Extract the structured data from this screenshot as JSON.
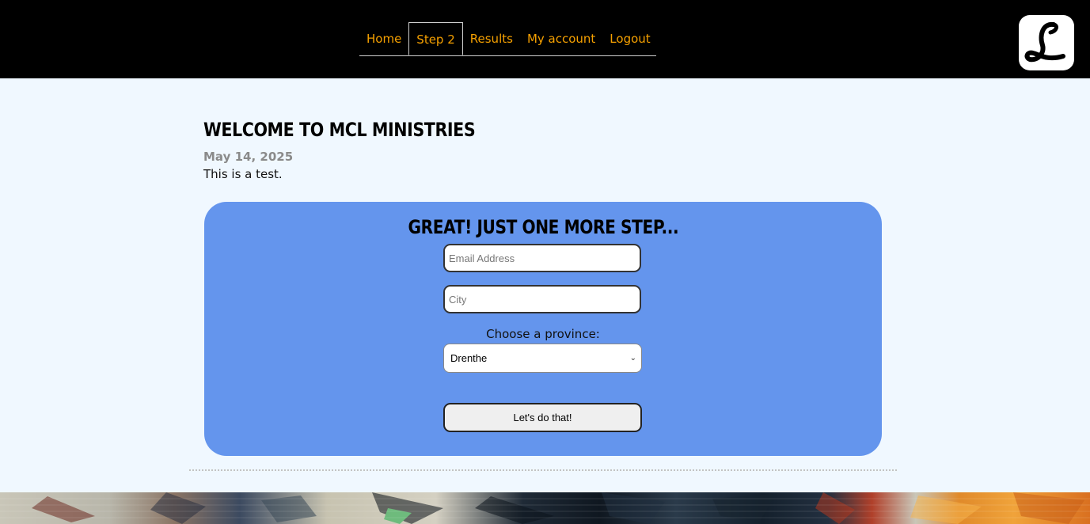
{
  "nav": {
    "items": [
      {
        "label": "Home"
      },
      {
        "label": "Step 2",
        "active": true
      },
      {
        "label": "Results"
      },
      {
        "label": "My account"
      },
      {
        "label": "Logout"
      }
    ]
  },
  "logo": {
    "letter": "L",
    "icon": "script-l-logo"
  },
  "post": {
    "title": "Welcome to MCL Ministries",
    "date": "May 14, 2025",
    "body": "This is a test."
  },
  "form": {
    "title": "Great! Just one more step...",
    "email_placeholder": "Email Address",
    "city_placeholder": "City",
    "province_label": "Choose a province:",
    "province_selected": "Drenthe",
    "submit_label": "Let's do that!"
  },
  "colors": {
    "header_bg": "#000000",
    "nav_text": "#f5a000",
    "page_bg": "#f0f8ff",
    "card_bg": "#6495ed"
  }
}
